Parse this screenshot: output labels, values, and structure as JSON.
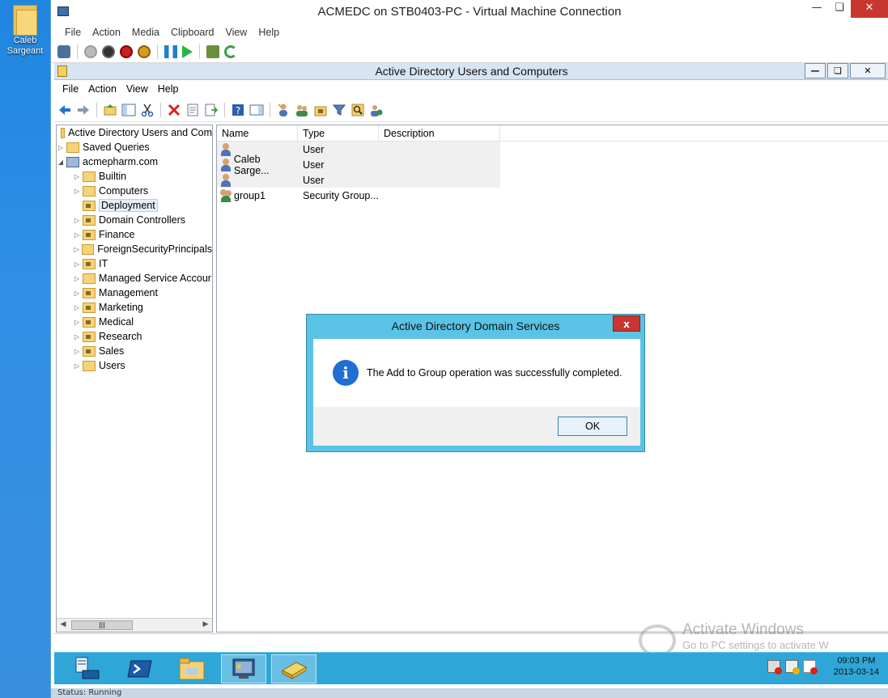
{
  "host": {
    "desktop_icon_label": "Caleb Sargeant"
  },
  "vm": {
    "title": "ACMEDC on STB0403-PC - Virtual Machine Connection",
    "menu": [
      "File",
      "Action",
      "Media",
      "Clipboard",
      "View",
      "Help"
    ],
    "status": "Status: Running"
  },
  "mmc": {
    "title": "Active Directory Users and Computers",
    "menu": [
      "File",
      "Action",
      "View",
      "Help"
    ],
    "tree": {
      "root": "Active Directory Users and Com",
      "saved_queries": "Saved Queries",
      "domain": "acmepharm.com",
      "ous": [
        "Builtin",
        "Computers",
        "Deployment",
        "Domain Controllers",
        "Finance",
        "ForeignSecurityPrincipals",
        "IT",
        "Managed Service Accour",
        "Management",
        "Marketing",
        "Medical",
        "Research",
        "Sales",
        "Users"
      ]
    },
    "list": {
      "columns": [
        "Name",
        "Type",
        "Description"
      ],
      "rows": [
        {
          "name": "",
          "type": "User"
        },
        {
          "name": "Caleb Sarge...",
          "type": "User"
        },
        {
          "name": "",
          "type": "User"
        },
        {
          "name": "group1",
          "type": "Security Group..."
        }
      ]
    }
  },
  "dialog": {
    "title": "Active Directory Domain Services",
    "close": "x",
    "message": "The Add to Group operation was successfully completed.",
    "ok": "OK"
  },
  "taskbar": {
    "time": "09:03 PM",
    "date": "2013-03-14"
  },
  "watermark": {
    "line1": "Activate Windows",
    "line2": "Go to PC settings to activate W"
  },
  "colors": {
    "dialog_frame": "#5ac3e6",
    "taskbar": "#2fa6d8",
    "close_red": "#c7372f"
  }
}
